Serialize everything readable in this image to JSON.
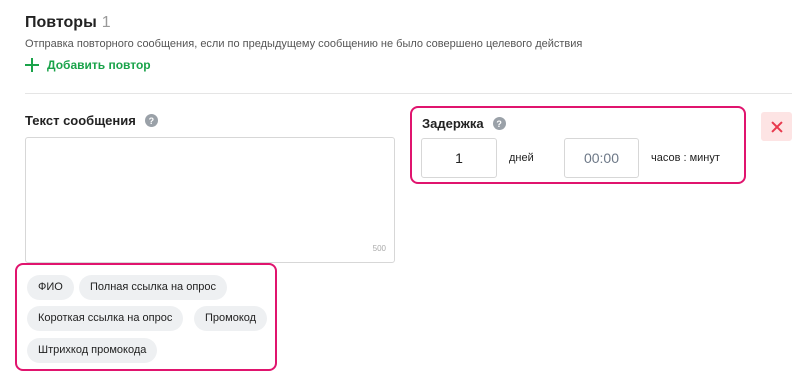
{
  "section": {
    "title": "Повторы",
    "count": "1",
    "subtitle": "Отправка повторного сообщения, если по предыдущему сообщению не было совершено целевого действия",
    "add_label": "Добавить повтор"
  },
  "message": {
    "label": "Текст сообщения",
    "value": "",
    "char_limit": "500"
  },
  "tags": [
    "ФИО",
    "Полная ссылка на опрос",
    "Короткая ссылка на опрос",
    "Промокод",
    "Штрихкод промокода"
  ],
  "delay": {
    "label": "Задержка",
    "days_value": "1",
    "days_unit": "дней",
    "time_value": "00:00",
    "time_unit": "часов : минут"
  },
  "help_glyph": "?",
  "icons": {
    "add": "plus-icon",
    "help": "help-icon",
    "delete": "close-icon"
  },
  "colors": {
    "accent_green": "#1aa34a",
    "highlight": "#e0146e",
    "delete_bg": "#fde4e4",
    "delete_icon": "#e8394d"
  }
}
